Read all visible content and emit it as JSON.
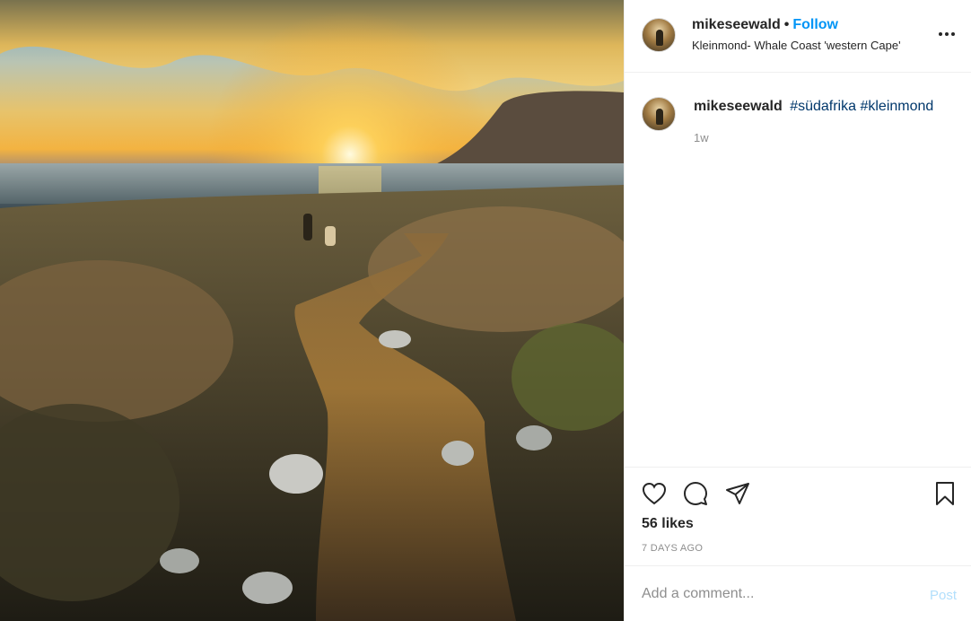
{
  "post": {
    "username": "mikeseewald",
    "follow_label": "Follow",
    "separator": "•",
    "location": "Kleinmond- Whale Coast 'western Cape'",
    "caption": {
      "username": "mikeseewald",
      "hashtags": [
        "#südafrika",
        "#kleinmond"
      ],
      "time_ago": "1w"
    },
    "likes": "56 likes",
    "date": "7 DAYS AGO",
    "comment": {
      "placeholder": "Add a comment...",
      "post_label": "Post"
    }
  },
  "icons": {
    "more": "more-options-icon",
    "like": "heart-icon",
    "comment": "comment-icon",
    "share": "paper-plane-icon",
    "save": "bookmark-icon"
  },
  "colors": {
    "follow": "#0095f6",
    "hashtag": "#00376b",
    "post_disabled": "#b2dffc",
    "muted": "#8e8e8e"
  }
}
